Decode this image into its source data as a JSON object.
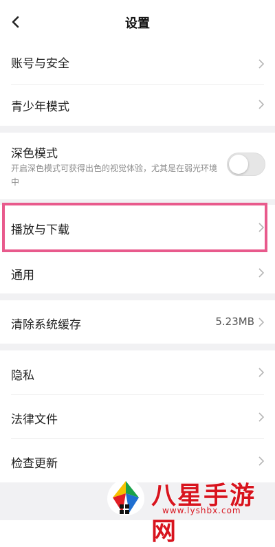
{
  "header": {
    "title": "设置",
    "back_icon": "chevron-left-icon"
  },
  "groups": {
    "account_security": "账号与安全",
    "teen_mode": "青少年模式",
    "dark_mode": {
      "label": "深色模式",
      "description": "开启深色模式可获得出色的视觉体验，尤其是在弱光环境中",
      "enabled": false
    },
    "playback_download": "播放与下载",
    "general": "通用",
    "clear_cache": {
      "label": "清除系统缓存",
      "value": "5.23MB"
    },
    "privacy": "隐私",
    "legal": "法律文件",
    "check_update": "检查更新"
  },
  "watermark": {
    "text": "八星手游网",
    "url": "www.lyshbx.com"
  },
  "colors": {
    "highlight": "#e85a8c",
    "section_gap": "#f1f1f3",
    "watermark_red": "#d8141e"
  }
}
